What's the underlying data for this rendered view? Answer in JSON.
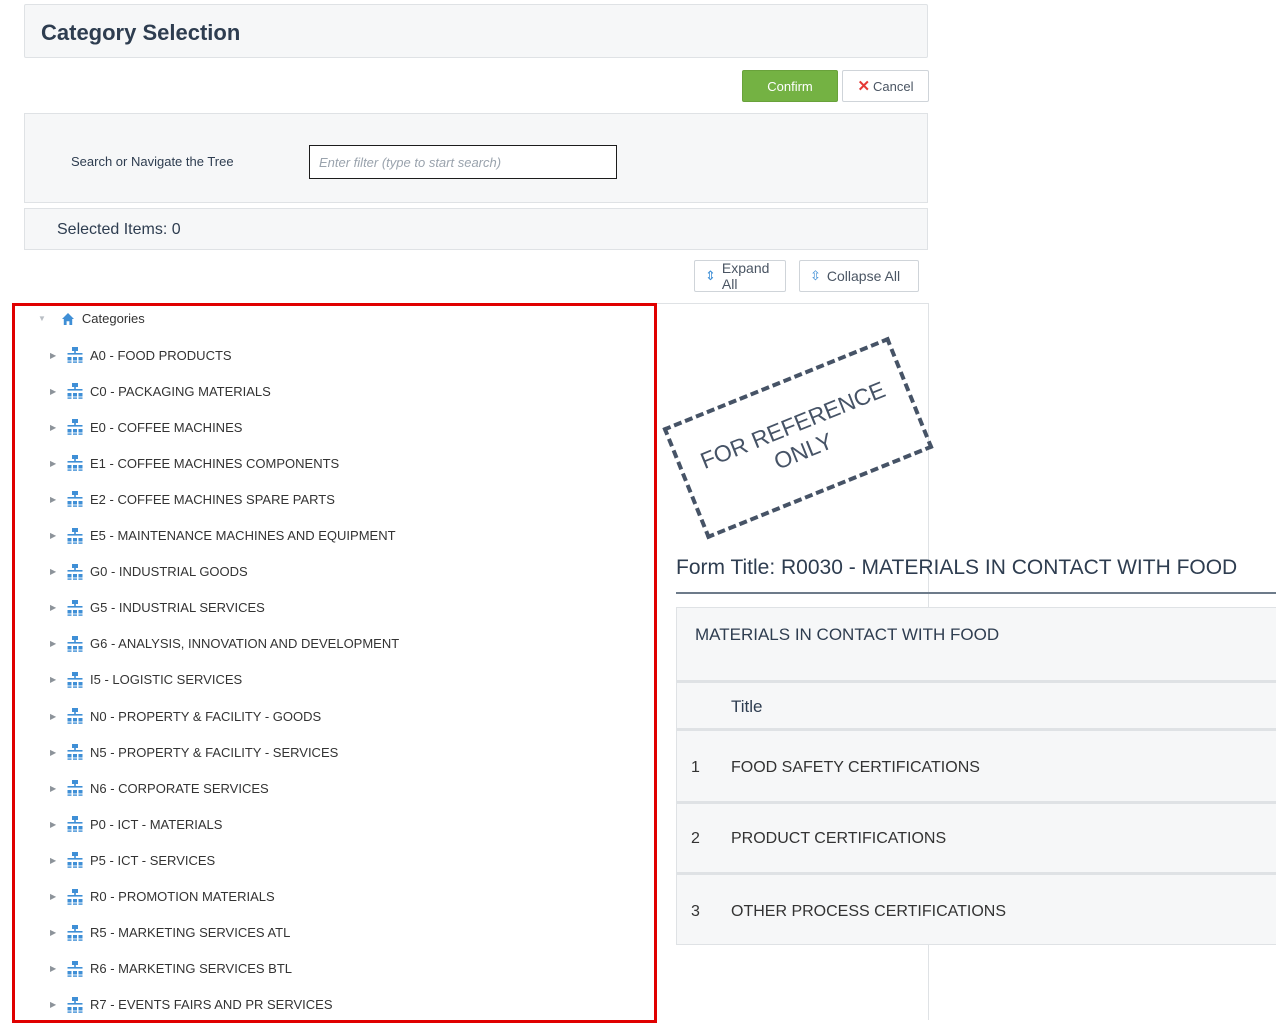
{
  "header": {
    "title": "Category Selection"
  },
  "actions": {
    "confirm": "Confirm",
    "cancel": "Cancel"
  },
  "search": {
    "label": "Search or Navigate the Tree",
    "placeholder": "Enter filter (type to start search)"
  },
  "selected": {
    "text": "Selected Items: 0"
  },
  "tree_tools": {
    "expand_all": "Expand All",
    "collapse_all": "Collapse All"
  },
  "tree": {
    "root": "Categories",
    "items": [
      "A0 - FOOD PRODUCTS",
      "C0 - PACKAGING MATERIALS",
      "E0 - COFFEE MACHINES",
      "E1 - COFFEE MACHINES COMPONENTS",
      "E2 - COFFEE MACHINES SPARE PARTS",
      "E5 - MAINTENANCE MACHINES AND EQUIPMENT",
      "G0 - INDUSTRIAL GOODS",
      "G5 - INDUSTRIAL SERVICES",
      "G6 - ANALYSIS, INNOVATION AND DEVELOPMENT",
      "I5 - LOGISTIC SERVICES",
      "N0 - PROPERTY & FACILITY - GOODS",
      "N5 - PROPERTY & FACILITY - SERVICES",
      "N6 - CORPORATE SERVICES",
      "P0 - ICT - MATERIALS",
      "P5 - ICT - SERVICES",
      "R0 - PROMOTION MATERIALS",
      "R5 - MARKETING SERVICES ATL",
      "R6 - MARKETING SERVICES BTL",
      "R7 - EVENTS FAIRS AND PR SERVICES"
    ]
  },
  "stamp": {
    "line1": "FOR REFERENCE",
    "line2": "ONLY"
  },
  "form": {
    "title": "Form Title: R0030 - MATERIALS IN CONTACT WITH FOOD",
    "card_title": "MATERIALS IN CONTACT WITH FOOD",
    "column_title": "Title",
    "rows": [
      {
        "num": "1",
        "title": "FOOD SAFETY CERTIFICATIONS"
      },
      {
        "num": "2",
        "title": "PRODUCT CERTIFICATIONS"
      },
      {
        "num": "3",
        "title": "OTHER PROCESS CERTIFICATIONS"
      }
    ]
  },
  "colors": {
    "confirm_bg": "#74b243",
    "cancel_x": "#e53935",
    "highlight_border": "#e00000",
    "tree_icon": "#3f8fd6"
  }
}
